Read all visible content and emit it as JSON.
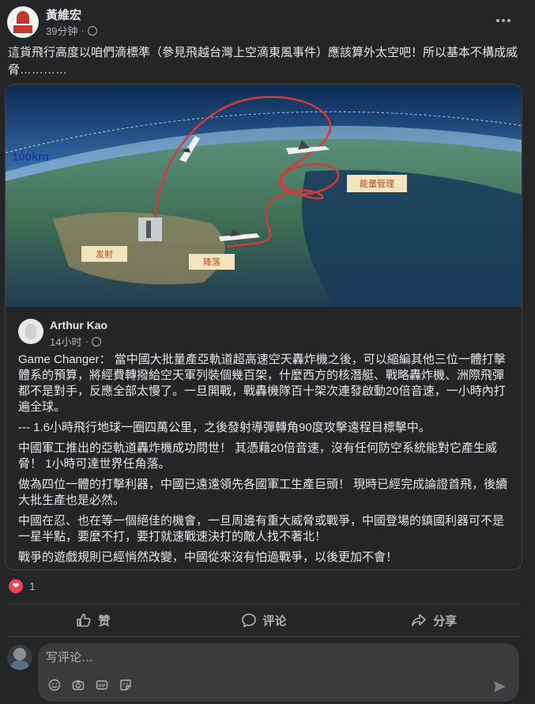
{
  "post": {
    "author": "黃維宏",
    "time": "39分钟",
    "separator": "·",
    "text": "這貨飛行高度以咱們滴標準（參見飛越台灣上空滴東風事件）應該算外太空吧！所以基本不構成威脅…………"
  },
  "image": {
    "altitude_label": "100km",
    "label_launch": "发射",
    "label_landing": "降落",
    "label_energy": "能量管理"
  },
  "shared": {
    "author": "Arthur Kao",
    "time": "14小时",
    "separator": "·",
    "paragraphs": [
      "Game Changer： 當中國大批量產亞軌道超高速空天轟炸機之後，可以縮編其他三位一體打擊體系的預算，將經費轉撥給空天軍列裝個幾百架，什麼西方的核潛艇、戰略轟炸機、洲際飛彈都不是對手，反應全部太慢了。一旦開戰，戰轟機隊百十架次連發啟動20倍音速，一小時內打遍全球。",
      "--- 1.6小時飛行地球一圈四萬公里，之後發射導彈轉角90度攻擊遠程目標擊中。",
      "中國軍工推出的亞軌道轟炸機成功問世！ 其憑藉20倍音速，沒有任何防空系統能對它產生威脅！ 1小時可達世界任角落。",
      "做為四位一體的打擊利器，中國已遠遠領先各國軍工生產巨頭！ 現時已經完成論證首飛，後續大批生產也是必然。",
      "中國在忍、也在等一個絕佳的機會，一旦周邊有重大威脅或戰爭，中國登場的鎮國利器可不是一星半點，要麼不打，要打就速戰速決打的敵人找不著北！",
      "戰爭的遊戲規則已經悄然改變，中國從來沒有怕過戰爭，以後更加不會！"
    ]
  },
  "reactions": {
    "count": "1"
  },
  "actions": {
    "like": "赞",
    "comment": "评论",
    "share": "分享"
  },
  "comment_box": {
    "placeholder": "写评论…",
    "gif_label": "GIF"
  },
  "colors": {
    "background": "#242526",
    "text_primary": "#e4e6eb",
    "text_secondary": "#b0b3b8",
    "heart": "#f33e58",
    "input_bg": "#3a3b3c"
  }
}
